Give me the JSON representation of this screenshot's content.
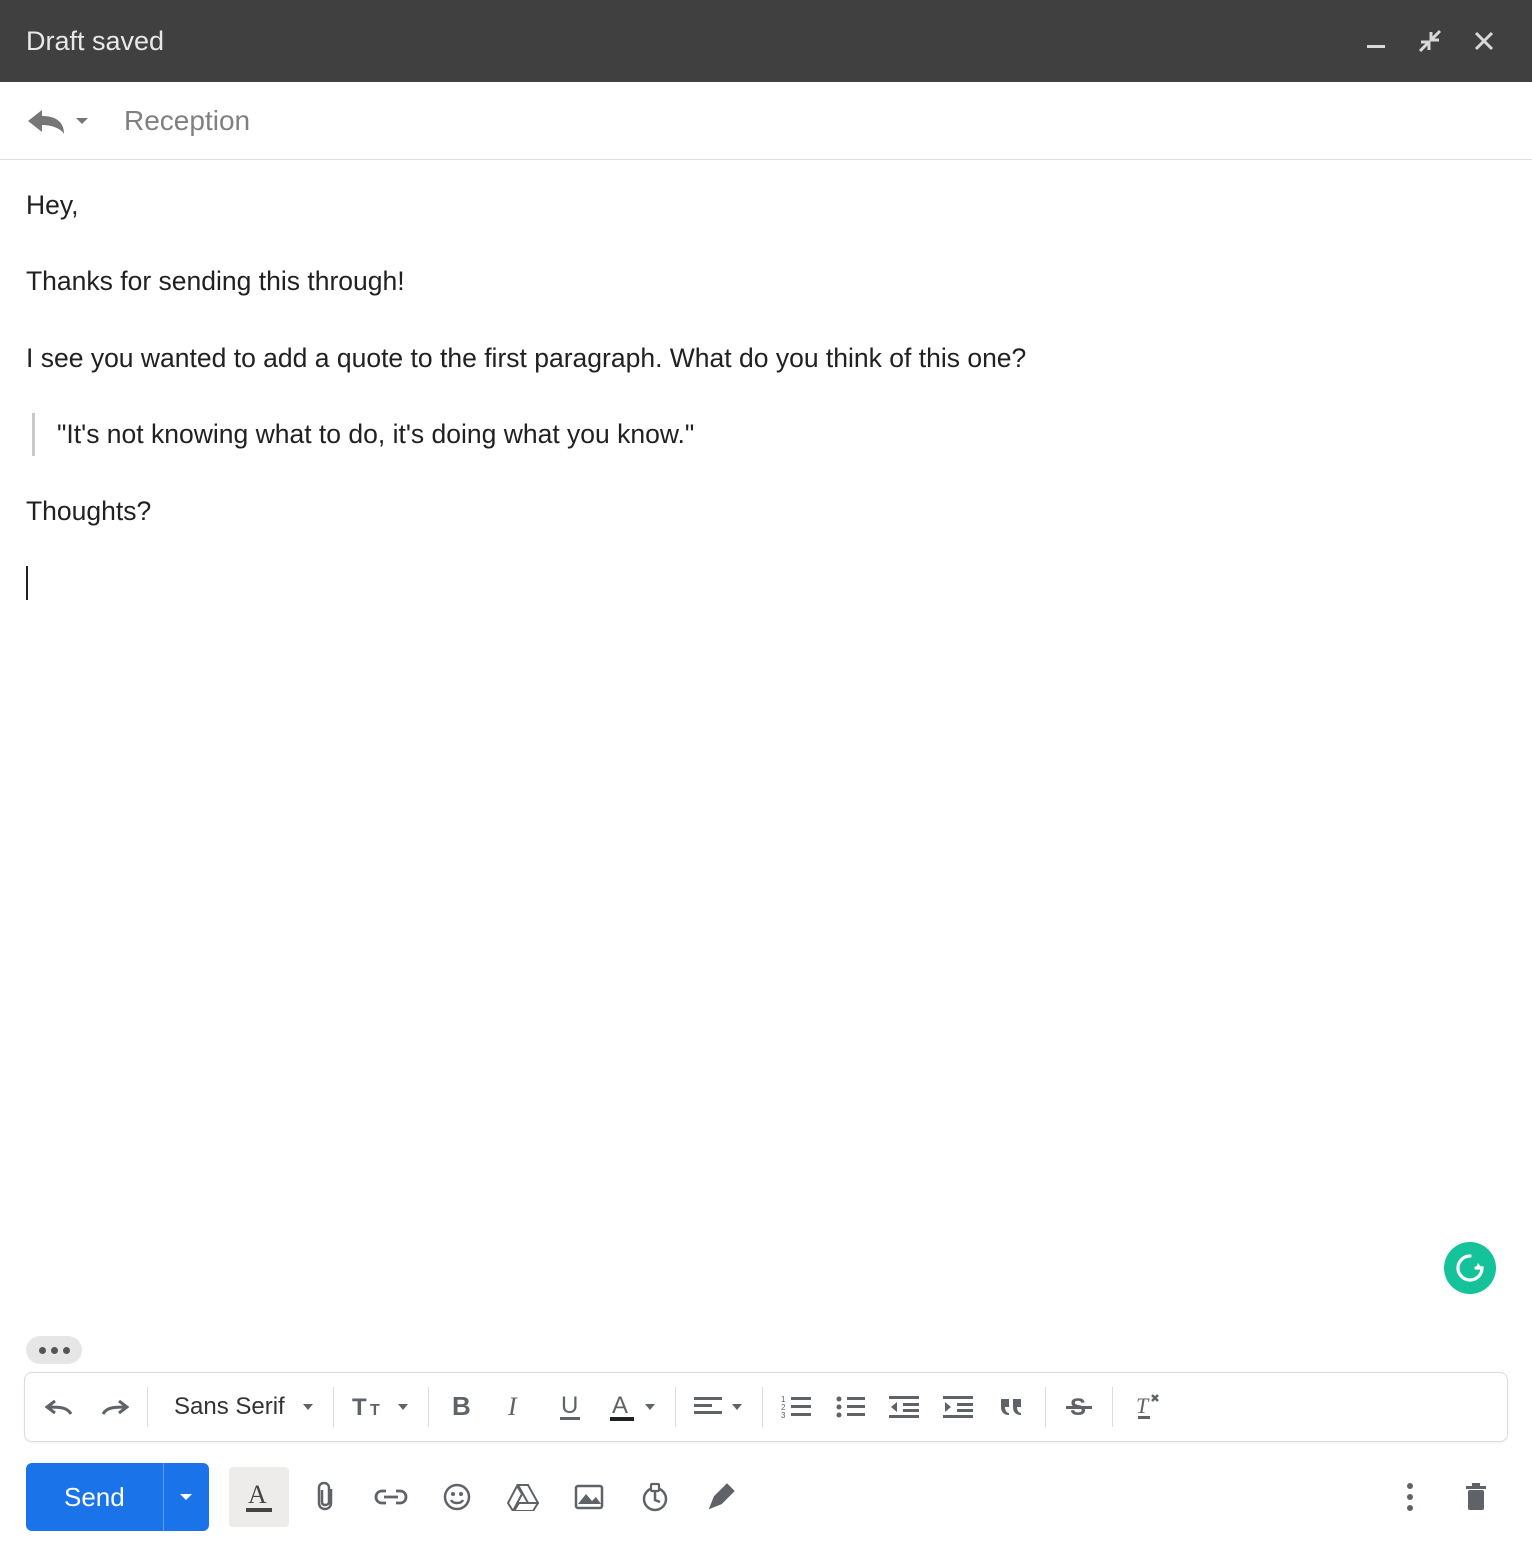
{
  "titlebar": {
    "title": "Draft saved"
  },
  "subject": "Reception",
  "body": {
    "greeting": "Hey,",
    "line1": "Thanks for sending this through!",
    "line2": "I see you wanted to add a quote to the first paragraph. What do you think of this one?",
    "quote": "\"It's not knowing what to do, it's doing what you know.\"",
    "closing": "Thoughts?"
  },
  "toolbar": {
    "font": "Sans Serif"
  },
  "send": {
    "label": "Send"
  }
}
